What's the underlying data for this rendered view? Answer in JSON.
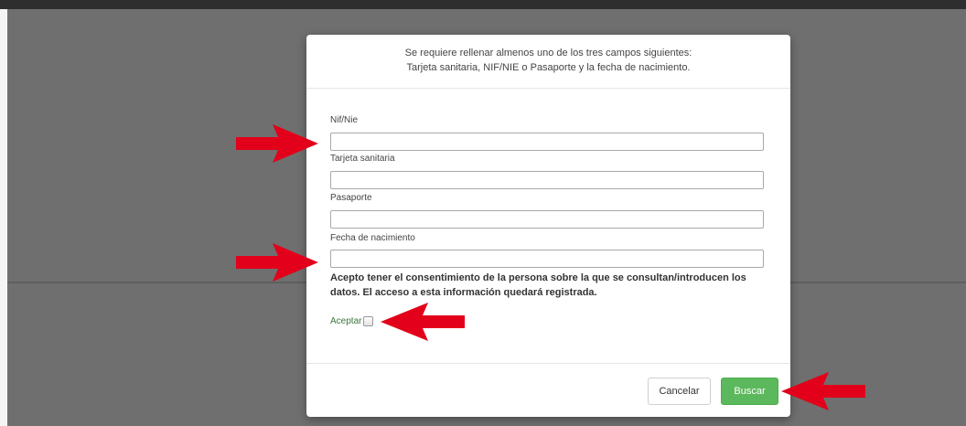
{
  "modal": {
    "header_line1": "Se requiere rellenar almenos uno de los tres campos siguientes:",
    "header_line2": "Tarjeta sanitaria, NIF/NIE o Pasaporte y la fecha de nacimiento."
  },
  "form": {
    "nif_label": "Nif/Nie",
    "nif_value": "",
    "tarjeta_label": "Tarjeta sanitaria",
    "tarjeta_value": "",
    "pasaporte_label": "Pasaporte",
    "pasaporte_value": "",
    "fecha_label": "Fecha de nacimiento",
    "fecha_value": "",
    "consent_text": "Acepto tener el consentimiento de la persona sobre la que se consultan/introducen los datos. El acceso a esta información quedará registrada.",
    "accept_label": "Aceptar",
    "accept_checked": false
  },
  "footer": {
    "cancel_label": "Cancelar",
    "search_label": "Buscar"
  },
  "colors": {
    "backdrop": "#6f6f6f",
    "accent_green": "#5cb85c",
    "accept_label": "#3c763d",
    "arrow_red": "#e2001a"
  },
  "annotations": {
    "arrow_icon": "red-arrow-icon"
  }
}
